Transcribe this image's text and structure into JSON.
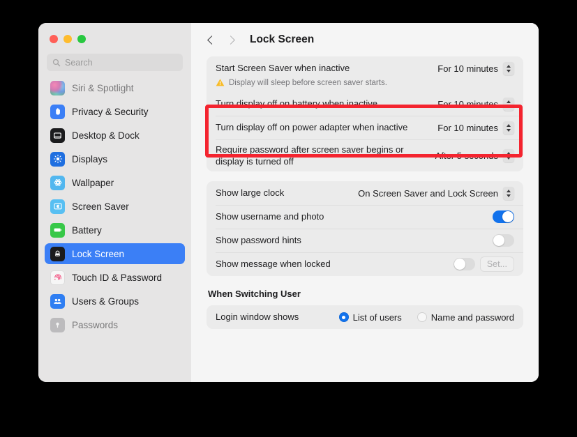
{
  "window": {
    "traffic_lights": [
      "close",
      "minimize",
      "zoom"
    ]
  },
  "sidebar": {
    "search": {
      "placeholder": "Search",
      "value": "",
      "icon": "search-icon"
    },
    "items": [
      {
        "label": "Siri & Spotlight",
        "icon": "siri-icon",
        "selected": false,
        "partial": true
      },
      {
        "label": "Privacy & Security",
        "icon": "privacy-hand-icon",
        "selected": false,
        "partial": false
      },
      {
        "label": "Desktop & Dock",
        "icon": "desktop-dock-icon",
        "selected": false,
        "partial": false
      },
      {
        "label": "Displays",
        "icon": "displays-icon",
        "selected": false,
        "partial": false
      },
      {
        "label": "Wallpaper",
        "icon": "wallpaper-icon",
        "selected": false,
        "partial": false
      },
      {
        "label": "Screen Saver",
        "icon": "screen-saver-icon",
        "selected": false,
        "partial": false
      },
      {
        "label": "Battery",
        "icon": "battery-icon",
        "selected": false,
        "partial": false
      },
      {
        "label": "Lock Screen",
        "icon": "lock-screen-icon",
        "selected": true,
        "partial": false
      },
      {
        "label": "Touch ID & Password",
        "icon": "touch-id-icon",
        "selected": false,
        "partial": false
      },
      {
        "label": "Users & Groups",
        "icon": "users-groups-icon",
        "selected": false,
        "partial": false
      },
      {
        "label": "Passwords",
        "icon": "passwords-key-icon",
        "selected": false,
        "partial": true
      }
    ]
  },
  "toolbar": {
    "back_icon": "chevron-left-icon",
    "forward_icon": "chevron-right-icon",
    "title": "Lock Screen"
  },
  "main": {
    "group1": {
      "screen_saver": {
        "label": "Start Screen Saver when inactive",
        "value": "For 10 minutes"
      },
      "warning": {
        "icon": "warning-triangle-icon",
        "text": "Display will sleep before screen saver starts."
      },
      "display_off_battery": {
        "label": "Turn display off on battery when inactive",
        "value": "For 10 minutes"
      },
      "display_off_power": {
        "label": "Turn display off on power adapter when inactive",
        "value": "For 10 minutes"
      },
      "require_password": {
        "label": "Require password after screen saver begins or display is turned off",
        "value": "After 5 seconds"
      }
    },
    "group2": {
      "large_clock": {
        "label": "Show large clock",
        "value": "On Screen Saver and Lock Screen"
      },
      "username_photo": {
        "label": "Show username and photo",
        "toggle": "on"
      },
      "password_hints": {
        "label": "Show password hints",
        "toggle": "off"
      },
      "message_locked": {
        "label": "Show message when locked",
        "toggle": "off",
        "button": "Set..."
      }
    },
    "switching_user": {
      "heading": "When Switching User",
      "login_window": {
        "label": "Login window shows",
        "options": [
          {
            "label": "List of users",
            "selected": true
          },
          {
            "label": "Name and password",
            "selected": false
          }
        ]
      }
    }
  },
  "annotation": {
    "highlight_color": "#f4242f",
    "highlights": [
      "Turn display off on battery when inactive",
      "Turn display off on power adapter when inactive"
    ]
  }
}
